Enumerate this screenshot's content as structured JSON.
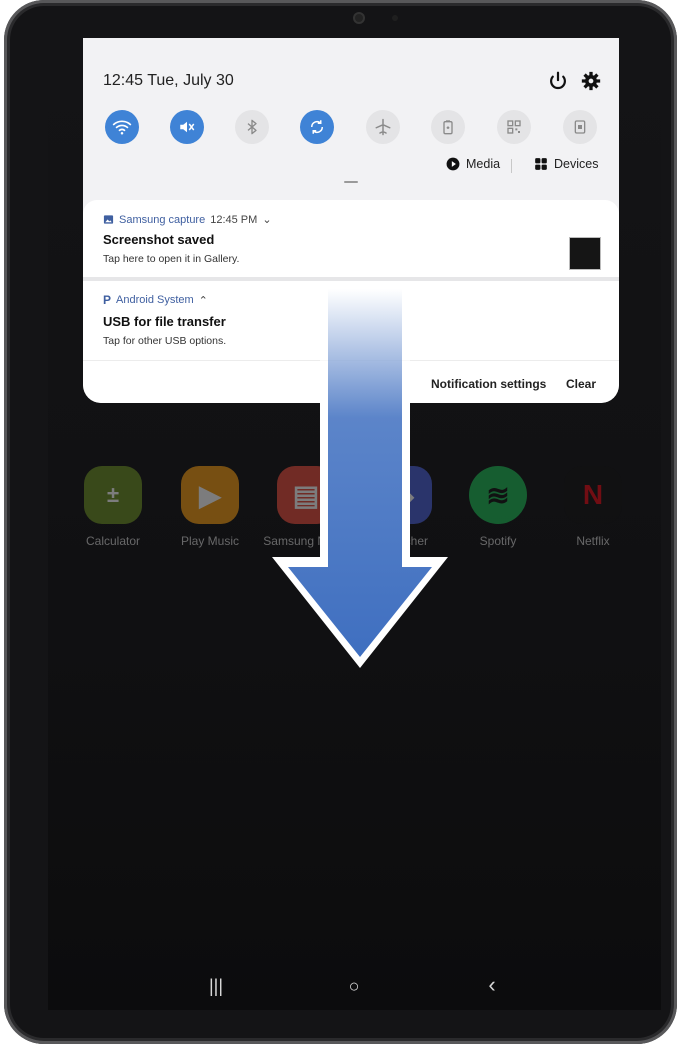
{
  "status": {
    "time_date": "12:45  Tue, July 30"
  },
  "quick_settings": {
    "toggles": [
      {
        "name": "wifi",
        "state": "on"
      },
      {
        "name": "sound-off",
        "state": "on"
      },
      {
        "name": "bluetooth",
        "state": "off"
      },
      {
        "name": "auto-rotate",
        "state": "on"
      },
      {
        "name": "airplane-mode",
        "state": "off"
      },
      {
        "name": "power-saving",
        "state": "off"
      },
      {
        "name": "qr-scanner",
        "state": "off"
      },
      {
        "name": "secure-folder",
        "state": "off"
      }
    ],
    "media_label": "Media",
    "devices_label": "Devices",
    "accent_color": "#3f83d6"
  },
  "notifications": [
    {
      "app": "Samsung capture",
      "time": "12:45 PM",
      "title": "Screenshot saved",
      "text": "Tap here to open it in Gallery."
    },
    {
      "app": "Android System",
      "title": "USB for file transfer",
      "text": "Tap for other USB options."
    }
  ],
  "actions": {
    "settings_label": "Notification settings",
    "clear_label": "Clear"
  },
  "home_apps": [
    {
      "label": "Calculator"
    },
    {
      "label": "Play Music"
    },
    {
      "label": "Samsung Notes"
    },
    {
      "label": "Launcher"
    },
    {
      "label": "Spotify"
    },
    {
      "label": "Netflix"
    }
  ],
  "arrow_color": "#3f6fc0"
}
